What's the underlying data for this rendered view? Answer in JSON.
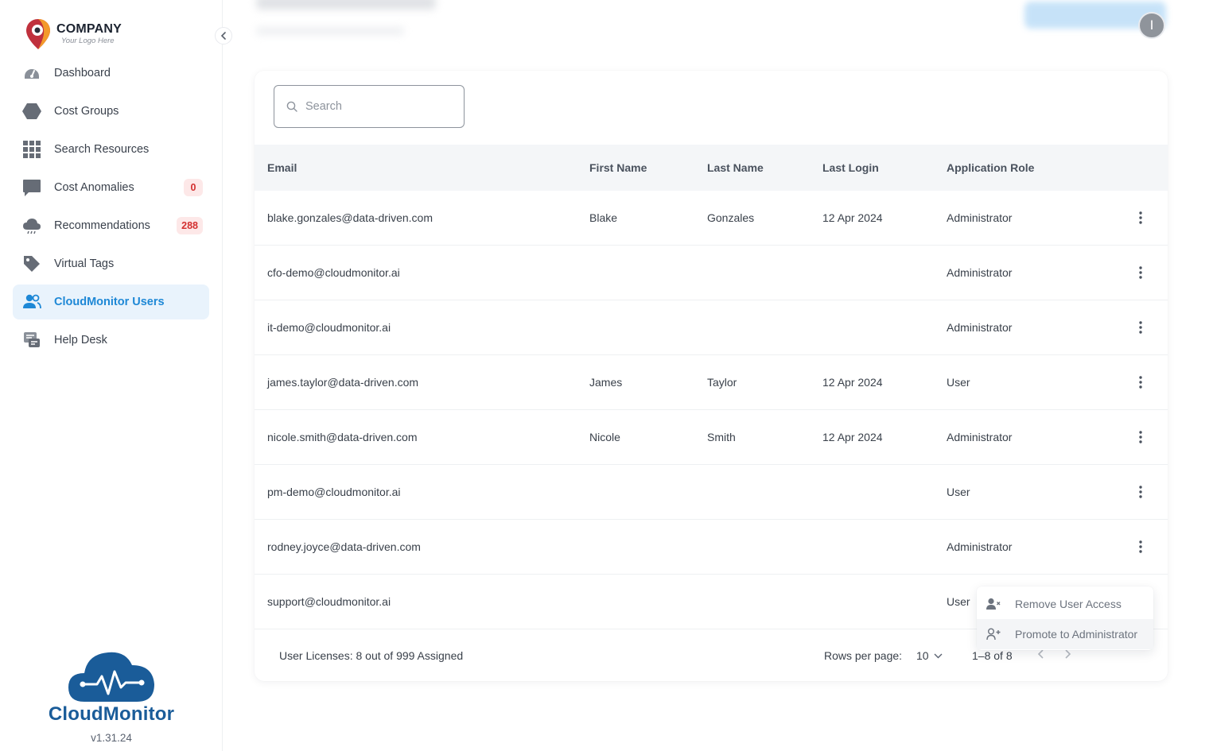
{
  "logo": {
    "company": "COMPANY",
    "tagline": "Your Logo Here"
  },
  "sidebar": {
    "items": [
      {
        "label": "Dashboard",
        "icon": "gauge-icon"
      },
      {
        "label": "Cost Groups",
        "icon": "hexagon-icon"
      },
      {
        "label": "Search Resources",
        "icon": "grid-icon"
      },
      {
        "label": "Cost Anomalies",
        "icon": "chat-bubble-icon",
        "badge": "0"
      },
      {
        "label": "Recommendations",
        "icon": "cloud-icon",
        "badge": "288"
      },
      {
        "label": "Virtual Tags",
        "icon": "tag-icon"
      },
      {
        "label": "CloudMonitor Users",
        "icon": "users-icon",
        "active": true
      },
      {
        "label": "Help Desk",
        "icon": "help-desk-icon"
      }
    ]
  },
  "brand": {
    "name": "CloudMonitor",
    "version": "v1.31.24"
  },
  "header": {
    "avatar_initial": "I"
  },
  "search": {
    "placeholder": "Search"
  },
  "table": {
    "columns": [
      "Email",
      "First Name",
      "Last Name",
      "Last Login",
      "Application Role"
    ],
    "rows": [
      {
        "email": "blake.gonzales@data-driven.com",
        "first": "Blake",
        "last": "Gonzales",
        "login": "12 Apr 2024",
        "role": "Administrator"
      },
      {
        "email": "cfo-demo@cloudmonitor.ai",
        "first": "",
        "last": "",
        "login": "",
        "role": "Administrator"
      },
      {
        "email": "it-demo@cloudmonitor.ai",
        "first": "",
        "last": "",
        "login": "",
        "role": "Administrator"
      },
      {
        "email": "james.taylor@data-driven.com",
        "first": "James",
        "last": "Taylor",
        "login": "12 Apr 2024",
        "role": "User"
      },
      {
        "email": "nicole.smith@data-driven.com",
        "first": "Nicole",
        "last": "Smith",
        "login": "12 Apr 2024",
        "role": "Administrator"
      },
      {
        "email": "pm-demo@cloudmonitor.ai",
        "first": "",
        "last": "",
        "login": "",
        "role": "User"
      },
      {
        "email": "rodney.joyce@data-driven.com",
        "first": "",
        "last": "",
        "login": "",
        "role": "Administrator"
      },
      {
        "email": "support@cloudmonitor.ai",
        "first": "",
        "last": "",
        "login": "",
        "role": "User"
      }
    ]
  },
  "footer": {
    "licenses": "User Licenses: 8 out of 999 Assigned",
    "rows_per_page_label": "Rows per page:",
    "rows_per_page_value": "10",
    "range": "1–8 of 8"
  },
  "context_menu": {
    "items": [
      {
        "label": "Remove User Access",
        "icon": "user-remove-icon"
      },
      {
        "label": "Promote to Administrator",
        "icon": "user-add-icon"
      }
    ]
  },
  "colors": {
    "accent": "#1e88d6",
    "active_bg": "#e9f3fc",
    "badge_bg": "#fde8e8",
    "badge_text": "#d32f2f",
    "brand": "#1a5c99"
  }
}
